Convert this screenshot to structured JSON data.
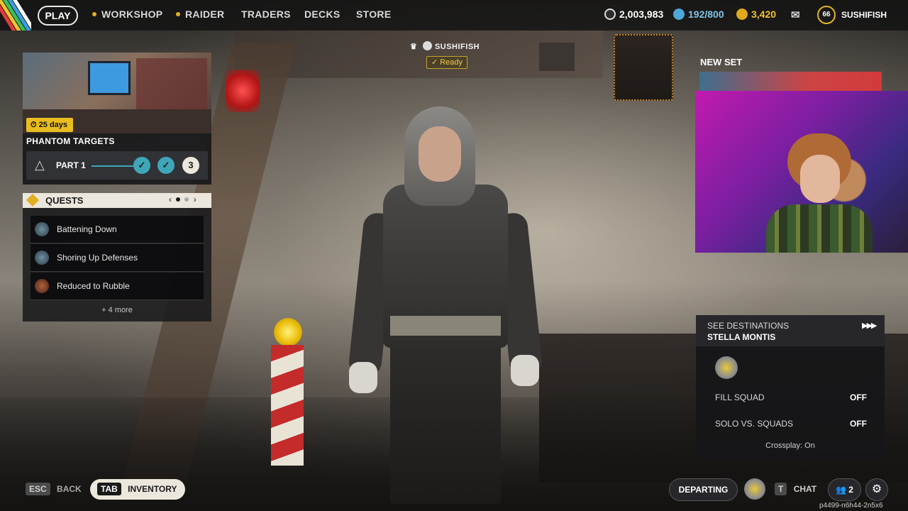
{
  "nav": {
    "play": "PLAY",
    "items": [
      {
        "label": "WORKSHOP",
        "dot": true
      },
      {
        "label": "RAIDER",
        "dot": true
      },
      {
        "label": "TRADERS",
        "dot": false
      },
      {
        "label": "DECKS",
        "dot": false
      },
      {
        "label": "STORE",
        "dot": false
      }
    ]
  },
  "currency": {
    "credits": "2,003,983",
    "stash": "192/800",
    "coins": "3,420"
  },
  "profile": {
    "level": "66",
    "name": "SUSHIFISH"
  },
  "player_tag": {
    "name": "SUSHIFISH",
    "status": "Ready"
  },
  "phantom": {
    "days": "25 days",
    "title": "PHANTOM TARGETS",
    "part": "PART 1",
    "next_step": "3"
  },
  "quests": {
    "title": "QUESTS",
    "items": [
      {
        "label": "Battening Down"
      },
      {
        "label": "Shoring Up Defenses"
      },
      {
        "label": "Reduced to Rubble"
      }
    ],
    "more": "+ 4 more"
  },
  "new_set": {
    "label": "NEW SET"
  },
  "destinations": {
    "see": "SEE DESTINATIONS",
    "location": "STELLA MONTIS",
    "fill_squad_label": "FILL SQUAD",
    "fill_squad_value": "OFF",
    "solo_label": "SOLO VS. SQUADS",
    "solo_value": "OFF",
    "crossplay": "Crossplay: On"
  },
  "bottom": {
    "esc_key": "ESC",
    "back": "BACK",
    "tab_key": "TAB",
    "inventory": "INVENTORY",
    "departing": "DEPARTING",
    "chat_key": "T",
    "chat": "CHAT",
    "party_count": "2",
    "session_id": "p4499-n6h44-2n5x6"
  },
  "colors": {
    "accent_yellow": "#e0b021",
    "teal": "#3fa6b7"
  }
}
